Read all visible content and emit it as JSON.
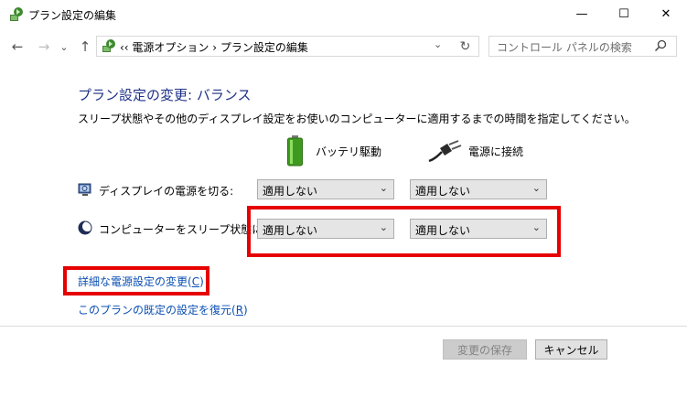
{
  "window": {
    "title": "プラン設定の編集",
    "minimize_glyph": "—",
    "maximize_glyph": "☐",
    "close_glyph": "✕"
  },
  "nav": {
    "back_glyph": "←",
    "forward_glyph": "→",
    "recent_glyph": "⌄",
    "up_glyph": "↑",
    "address": "‹‹  電源オプション  ›  プラン設定の編集",
    "address_dropdown_glyph": "⌄",
    "refresh_glyph": "↻",
    "search_placeholder": "コントロール パネルの検索"
  },
  "content": {
    "heading": "プラン設定の変更: バランス",
    "description": "スリープ状態やその他のディスプレイ設定をお使いのコンピューターに適用するまでの時間を指定してください。",
    "battery_label": "バッテリ駆動",
    "plugged_label": "電源に接続",
    "rows": [
      {
        "label": "ディスプレイの電源を切る:",
        "battery_value": "適用しない",
        "plugged_value": "適用しない"
      },
      {
        "label": "コンピューターをスリープ状態にする:",
        "battery_value": "適用しない",
        "plugged_value": "適用しない"
      }
    ],
    "advanced_link": "詳細な電源設定の変更",
    "advanced_key": "C",
    "restore_link": "このプランの既定の設定を復元",
    "restore_key": "R"
  },
  "buttons": {
    "save": "変更の保存",
    "cancel": "キャンセル"
  },
  "colors": {
    "highlight": "#e60000",
    "heading": "#1e3287",
    "link": "#0b4fb3"
  },
  "icons": [
    "power-options-icon",
    "battery-icon",
    "plug-icon",
    "monitor-icon",
    "moon-icon",
    "search-icon",
    "refresh-icon"
  ]
}
